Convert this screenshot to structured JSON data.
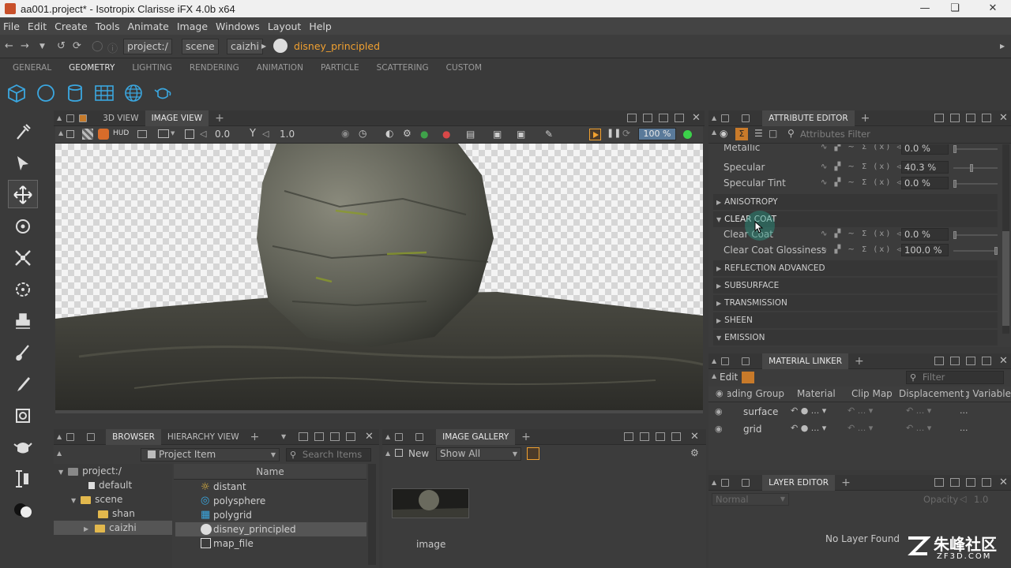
{
  "window": {
    "title": "aa001.project* - Isotropix Clarisse iFX 4.0b x64"
  },
  "menu": [
    "File",
    "Edit",
    "Create",
    "Tools",
    "Animate",
    "Image",
    "Windows",
    "Layout",
    "Help"
  ],
  "path": {
    "segments": [
      "project:/",
      "scene",
      "caizhi"
    ],
    "current": "disney_principled"
  },
  "shelf_tabs": [
    "GENERAL",
    "GEOMETRY",
    "LIGHTING",
    "RENDERING",
    "ANIMATION",
    "PARTICLE",
    "SCATTERING",
    "CUSTOM"
  ],
  "shelf_active": "GEOMETRY",
  "viewport": {
    "tabs": [
      "3D VIEW",
      "IMAGE VIEW"
    ],
    "active_tab": "IMAGE VIEW",
    "hud": "HUD",
    "exposure": "0.0",
    "gamma_symbol": "Y",
    "gamma": "1.0",
    "zoom": "100 %"
  },
  "attribute_editor": {
    "title": "ATTRIBUTE EDITOR",
    "filter_placeholder": "Attributes Filter",
    "rows_top": [
      {
        "label": "Metallic",
        "value": "0.0 %",
        "level": 0.0
      },
      {
        "label": "Specular",
        "value": "40.3 %",
        "level": 0.403
      },
      {
        "label": "Specular Tint",
        "value": "0.0 %",
        "level": 0.0
      }
    ],
    "sections": [
      "ANISOTROPY",
      "CLEAR COAT",
      "REFLECTION ADVANCED",
      "SUBSURFACE",
      "TRANSMISSION",
      "SHEEN",
      "EMISSION"
    ],
    "clear_coat_rows": [
      {
        "label": "Clear Coat",
        "value": "0.0 %",
        "level": 0.0
      },
      {
        "label": "Clear Coat Glossiness",
        "value": "100.0 %",
        "level": 1.0
      }
    ]
  },
  "material_linker": {
    "title": "MATERIAL LINKER",
    "edit": "Edit",
    "filter_placeholder": "Filter",
    "columns": [
      "Shading Group",
      "Material",
      "Clip Map",
      "Displacement",
      "Shading Variable"
    ],
    "rows": [
      "surface",
      "grid"
    ]
  },
  "layer_editor": {
    "title": "LAYER EDITOR",
    "mode": "Normal",
    "opacity_label": "Opacity",
    "opacity": "1.0",
    "empty": "No Layer Found"
  },
  "browser": {
    "tabs": [
      "BROWSER",
      "HIERARCHY VIEW"
    ],
    "dropdown": "Project Item",
    "search_placeholder": "Search Items",
    "column": "Name",
    "tree": [
      {
        "label": "project:/",
        "level": 0
      },
      {
        "label": "default",
        "level": 1
      },
      {
        "label": "scene",
        "level": 1
      },
      {
        "label": "shan",
        "level": 2
      },
      {
        "label": "caizhi",
        "level": 2
      }
    ],
    "items": [
      {
        "name": "distant",
        "icon": "light-icon"
      },
      {
        "name": "polysphere",
        "icon": "sphere-icon"
      },
      {
        "name": "polygrid",
        "icon": "grid-icon"
      },
      {
        "name": "disney_principled",
        "icon": "material-icon"
      },
      {
        "name": "map_file",
        "icon": "texture-icon"
      }
    ]
  },
  "gallery": {
    "title": "IMAGE GALLERY",
    "new_label": "New",
    "show": "Show All",
    "thumb_label": "image"
  },
  "watermark": {
    "text": "朱峰社区",
    "sub": "ZF3D.COM"
  },
  "colors": {
    "accent_orange": "#f0a030",
    "icon_blue": "#3aa7e0",
    "selection": "#555555"
  }
}
